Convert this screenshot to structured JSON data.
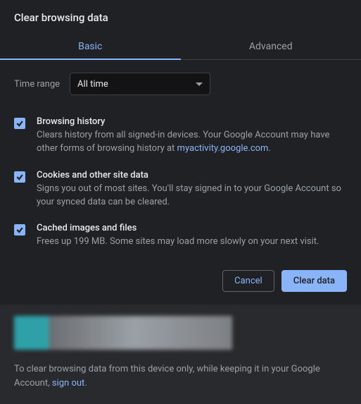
{
  "title": "Clear browsing data",
  "tabs": {
    "basic": "Basic",
    "advanced": "Advanced"
  },
  "timeRange": {
    "label": "Time range",
    "value": "All time"
  },
  "options": {
    "browsingHistory": {
      "title": "Browsing history",
      "descPre": "Clears history from all signed-in devices. Your Google Account may have other forms of browsing history at ",
      "link": "myactivity.google.com",
      "descPost": "."
    },
    "cookies": {
      "title": "Cookies and other site data",
      "desc": "Signs you out of most sites. You'll stay signed in to your Google Account so your synced data can be cleared."
    },
    "cache": {
      "title": "Cached images and files",
      "desc": "Frees up 199 MB. Some sites may load more slowly on your next visit."
    }
  },
  "buttons": {
    "cancel": "Cancel",
    "clear": "Clear data"
  },
  "footer": {
    "textPre": "To clear browsing data from this device only, while keeping it in your Google Account, ",
    "signOut": "sign out",
    "textPost": "."
  }
}
